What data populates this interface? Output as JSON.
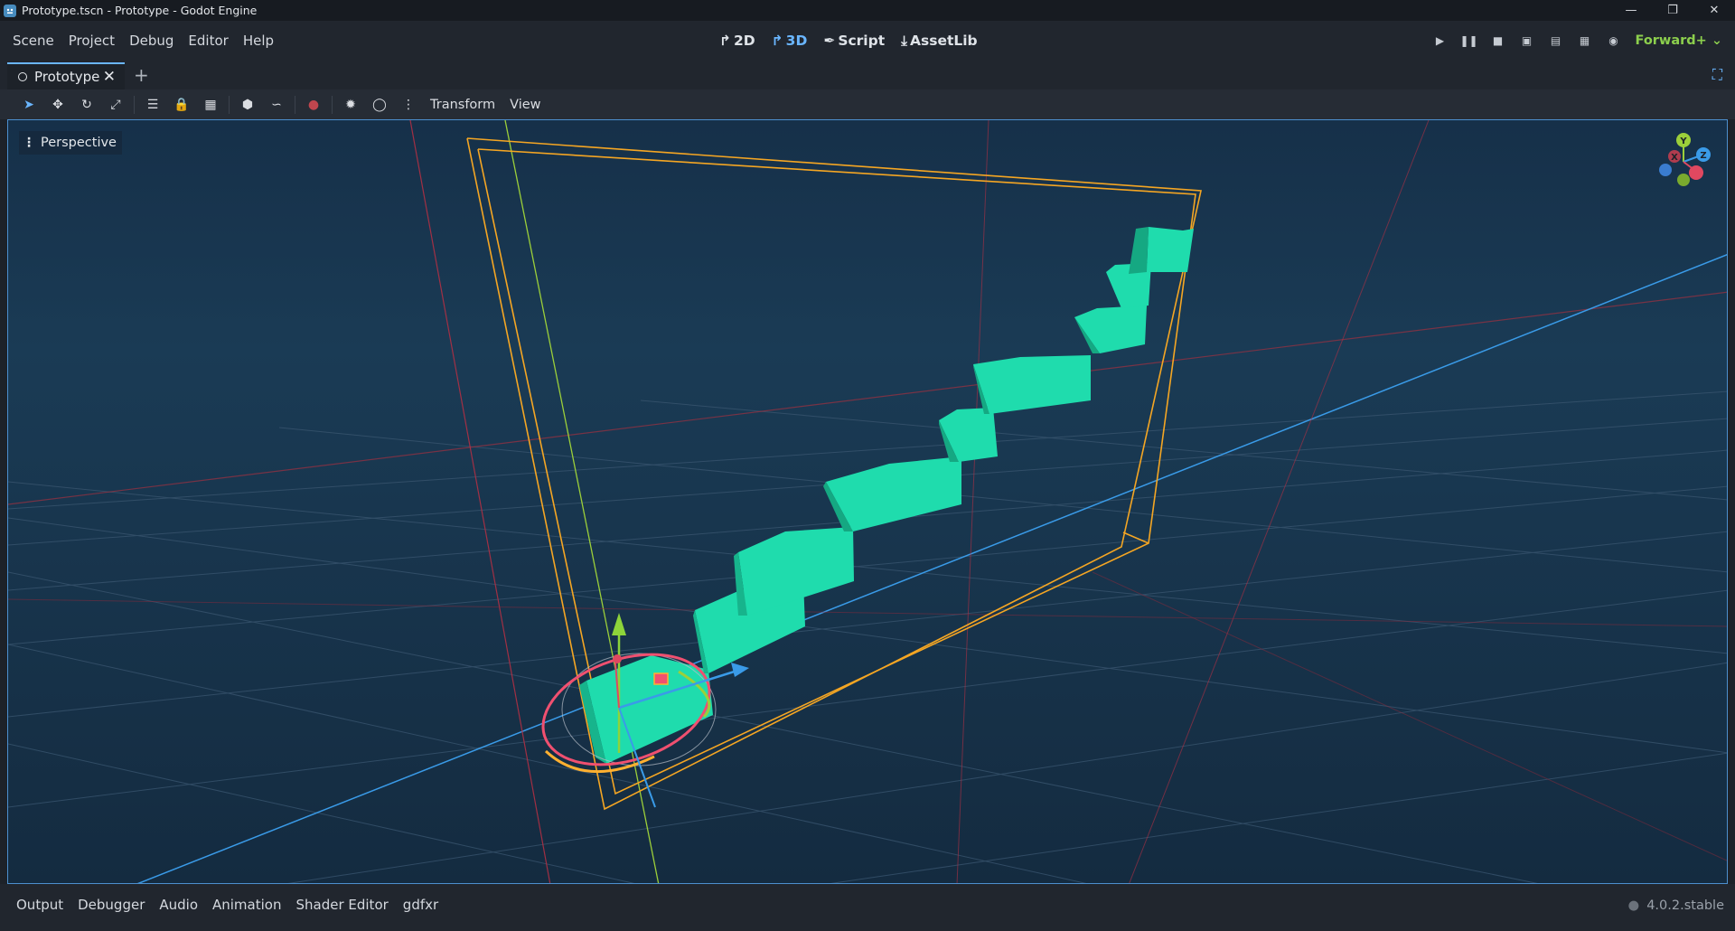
{
  "window": {
    "title": "Prototype.tscn - Prototype - Godot Engine",
    "controls": [
      "minimize-icon",
      "restore-icon",
      "close-icon"
    ]
  },
  "menu": {
    "items": [
      "Scene",
      "Project",
      "Debug",
      "Editor",
      "Help"
    ]
  },
  "workspaces": {
    "items": [
      {
        "label": "2D",
        "icon": "2d-icon"
      },
      {
        "label": "3D",
        "icon": "3d-icon",
        "active": true
      },
      {
        "label": "Script",
        "icon": "script-icon"
      },
      {
        "label": "AssetLib",
        "icon": "assetlib-icon"
      }
    ]
  },
  "run": {
    "renderer": "Forward+"
  },
  "tabs": {
    "items": [
      {
        "label": "Prototype",
        "active": true
      }
    ]
  },
  "toolbar": {
    "transform_label": "Transform",
    "view_label": "View"
  },
  "viewport": {
    "view_label": "Perspective",
    "gizmo_axes": [
      "Y",
      "X",
      "Z"
    ]
  },
  "bottom": {
    "tabs": [
      "Output",
      "Debugger",
      "Audio",
      "Animation",
      "Shader Editor",
      "gdfxr"
    ],
    "version": "4.0.2.stable"
  },
  "colors": {
    "accent": "#6ab6ff",
    "renderer": "#8ccf4d",
    "mesh": "#1fdcad",
    "bounds": "#f5a623"
  }
}
